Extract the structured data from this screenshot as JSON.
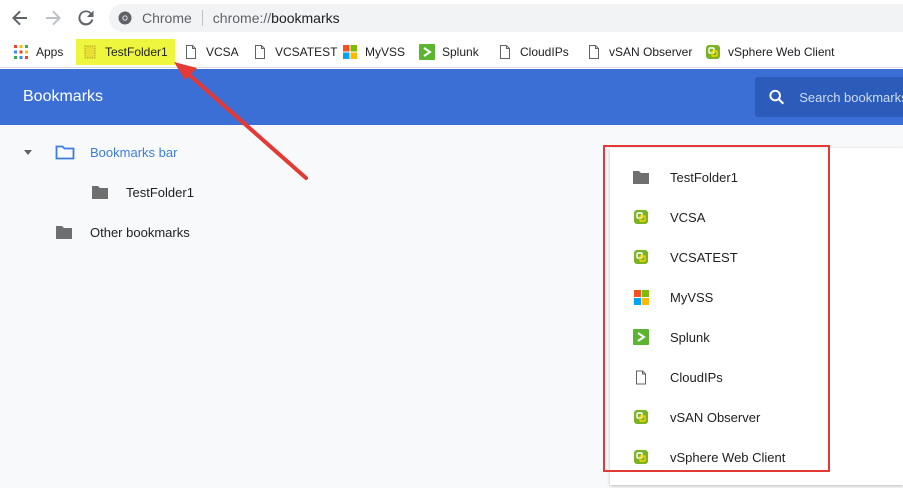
{
  "browser": {
    "site_label": "Chrome",
    "url_scheme": "chrome://",
    "url_host": "bookmarks"
  },
  "bookmarks_bar": {
    "items": [
      {
        "label": "Apps",
        "icon": "apps-grid-icon"
      },
      {
        "label": "TestFolder1",
        "icon": "folder-icon"
      },
      {
        "label": "VCSA",
        "icon": "page-icon"
      },
      {
        "label": "VCSATEST",
        "icon": "page-icon"
      },
      {
        "label": "MyVSS",
        "icon": "windows-logo-icon"
      },
      {
        "label": "Splunk",
        "icon": "splunk-icon"
      },
      {
        "label": "CloudIPs",
        "icon": "page-icon"
      },
      {
        "label": "vSAN Observer",
        "icon": "page-icon"
      },
      {
        "label": "vSphere Web Client",
        "icon": "vsphere-icon"
      }
    ]
  },
  "header": {
    "title": "Bookmarks",
    "search_placeholder": "Search bookmarks"
  },
  "sidebar": {
    "bookmarks_bar": "Bookmarks bar",
    "test_folder": "TestFolder1",
    "other_bookmarks": "Other bookmarks"
  },
  "list": {
    "items": [
      {
        "label": "TestFolder1",
        "icon": "folder-icon"
      },
      {
        "label": "VCSA",
        "icon": "vsphere-icon"
      },
      {
        "label": "VCSATEST",
        "icon": "vsphere-icon"
      },
      {
        "label": "MyVSS",
        "icon": "windows-logo-icon"
      },
      {
        "label": "Splunk",
        "icon": "splunk-icon"
      },
      {
        "label": "CloudIPs",
        "icon": "page-icon"
      },
      {
        "label": "vSAN Observer",
        "icon": "vsphere-icon"
      },
      {
        "label": "vSphere Web Client",
        "icon": "vsphere-icon"
      }
    ]
  },
  "colors": {
    "header_bg": "#3b6fd5",
    "search_bg": "#2b5cba",
    "highlight": "#eef73d",
    "annotation_red": "#e53935",
    "selected_blue": "#3b7ddd"
  }
}
